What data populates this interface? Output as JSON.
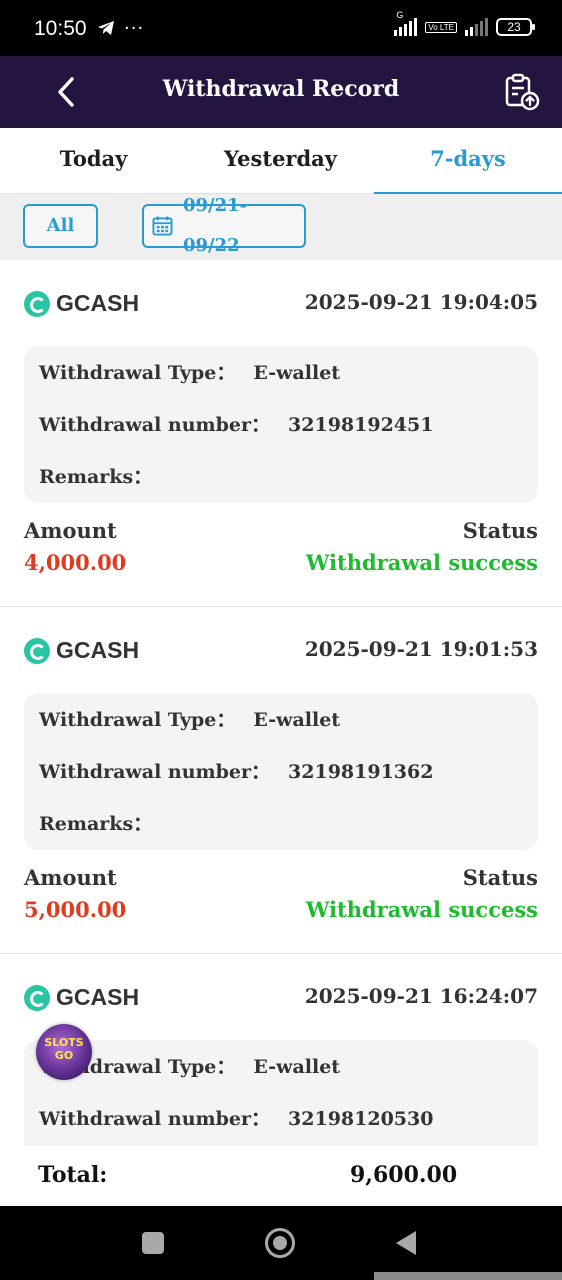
{
  "status_bar": {
    "time": "10:50",
    "left_icons": [
      "telegram-icon",
      "more-icon"
    ],
    "volte_label": "Vo LTE",
    "network_label": "G",
    "battery_level": "23"
  },
  "header": {
    "title": "Withdrawal Record",
    "back_icon": "chevron-left-icon",
    "action_icon": "clipboard-upload-icon"
  },
  "tabs": [
    {
      "label": "Today",
      "active": false
    },
    {
      "label": "Yesterday",
      "active": false
    },
    {
      "label": "7-days",
      "active": true
    }
  ],
  "filters": {
    "all_label": "All",
    "date_range": "09/21- 09/22"
  },
  "records": [
    {
      "provider": "GCASH",
      "datetime": "2025-09-21 19:04:05",
      "type_label": "Withdrawal Type：",
      "type_value": "E-wallet",
      "number_label": "Withdrawal number：",
      "number_value": "32198192451",
      "remarks_label": "Remarks：",
      "amount_label": "Amount",
      "amount": "4,000.00",
      "status_label": "Status",
      "status": "Withdrawal success"
    },
    {
      "provider": "GCASH",
      "datetime": "2025-09-21 19:01:53",
      "type_label": "Withdrawal Type：",
      "type_value": "E-wallet",
      "number_label": "Withdrawal number：",
      "number_value": "32198191362",
      "remarks_label": "Remarks：",
      "amount_label": "Amount",
      "amount": "5,000.00",
      "status_label": "Status",
      "status": "Withdrawal success"
    },
    {
      "provider": "GCASH",
      "datetime": "2025-09-21 16:24:07",
      "type_label": "Withdrawal Type：",
      "type_value": "E-wallet",
      "number_label": "Withdrawal number：",
      "number_value": "32198120530"
    }
  ],
  "floating_badge": {
    "line1": "SLOTS",
    "line2": "GO"
  },
  "total": {
    "label": "Total:",
    "value": "9,600.00"
  },
  "colors": {
    "header_bg": "#231440",
    "accent": "#2a9bd2",
    "amount": "#e03b1f",
    "success": "#1dbb2d"
  }
}
